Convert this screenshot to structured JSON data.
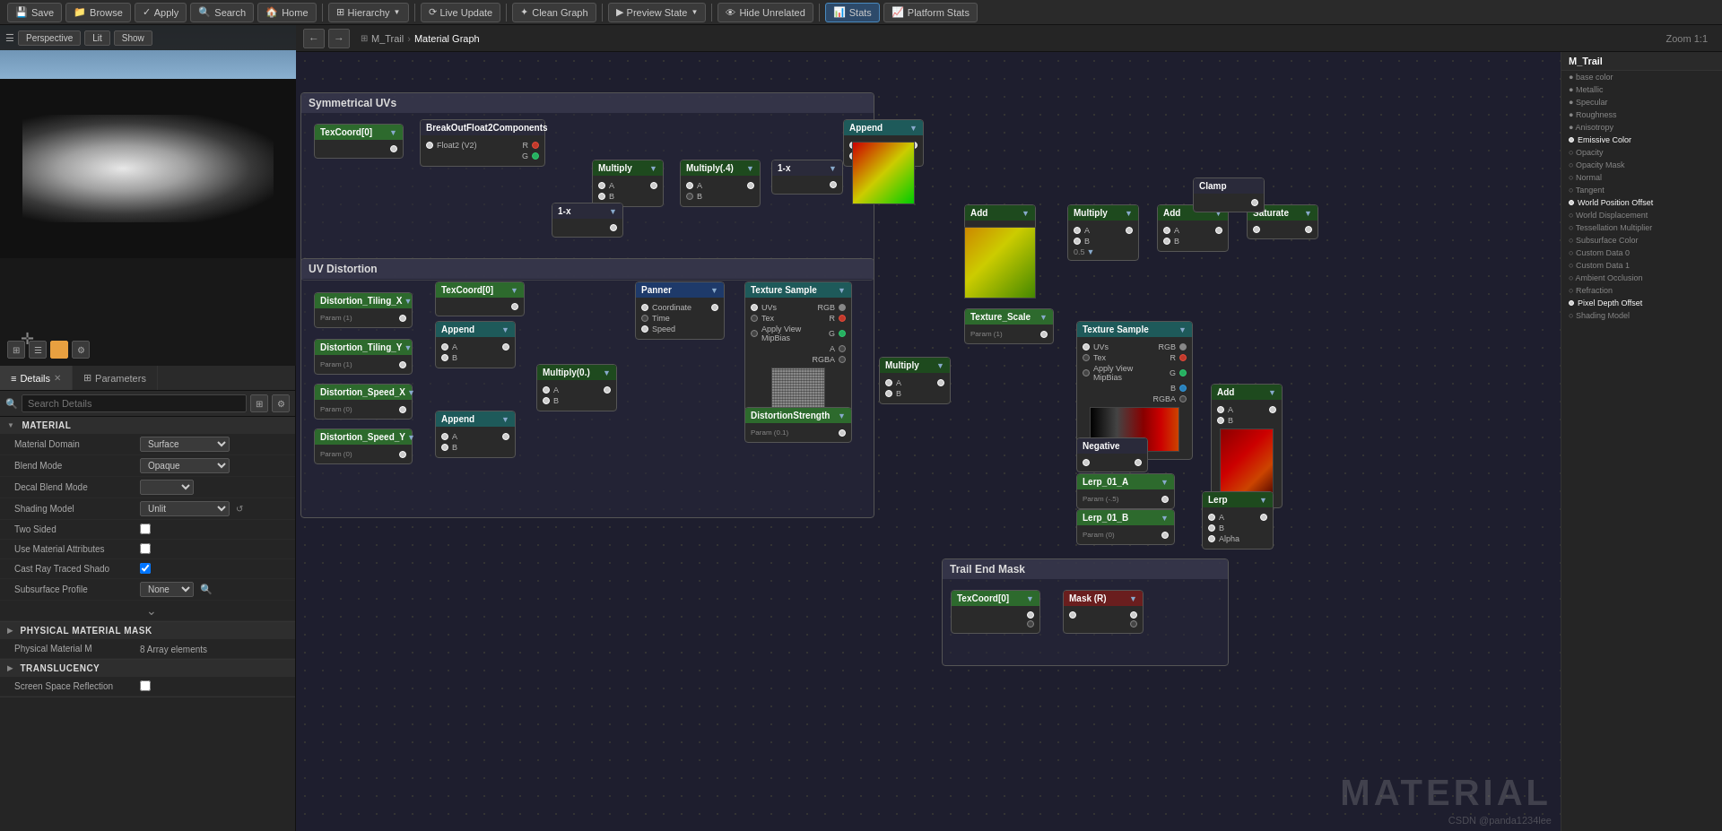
{
  "toolbar": {
    "save_label": "Save",
    "browse_label": "Browse",
    "apply_label": "Apply",
    "search_label": "Search",
    "home_label": "Home",
    "hierarchy_label": "Hierarchy",
    "live_update_label": "Live Update",
    "clean_graph_label": "Clean Graph",
    "preview_state_label": "Preview State",
    "hide_unrelated_label": "Hide Unrelated",
    "stats_label": "Stats",
    "platform_stats_label": "Platform Stats"
  },
  "viewport": {
    "mode_label": "Perspective",
    "lit_label": "Lit",
    "show_label": "Show"
  },
  "breadcrumb": {
    "root": "M_Trail",
    "separator": "›",
    "current": "Material Graph"
  },
  "zoom": "Zoom 1:1",
  "details": {
    "tab_label": "Details",
    "params_label": "Parameters",
    "search_placeholder": "Search Details",
    "sections": {
      "material": {
        "label": "MATERIAL",
        "domain_label": "Material Domain",
        "domain_value": "Surface",
        "blend_label": "Blend Mode",
        "blend_value": "Opaque",
        "decal_blend_label": "Decal Blend Mode",
        "shading_label": "Shading Model",
        "shading_value": "Unlit",
        "two_sided_label": "Two Sided",
        "use_mat_attrs_label": "Use Material Attributes",
        "cast_ray_label": "Cast Ray Traced Shado"
      },
      "subsurface_profile": {
        "label": "Subsurface Profile",
        "value": "None"
      },
      "physical_mask": {
        "label": "PHYSICAL MATERIAL MASK",
        "physical_label": "Physical Material M",
        "physical_value": "8 Array elements"
      },
      "translucency": {
        "label": "TRANSLUCENCY",
        "screen_space_label": "Screen Space Reflection"
      }
    }
  },
  "graph": {
    "symmetrical_uvs_label": "Symmetrical UVs",
    "uv_distortion_label": "UV Distortion",
    "trail_end_mask_label": "Trail End Mask",
    "nodes": {
      "tex_coord_0": "TexCoord[0]",
      "break_out_float2": "BreakOutFloat2Components",
      "float_v2": "Float2 (V2)",
      "multiply": "Multiply",
      "multiply_4": "Multiply(.4)",
      "one_minus_x": "1-x",
      "append": "Append",
      "add": "Add",
      "add2": "Add",
      "multiply2": "Multiply",
      "saturate": "Saturate",
      "clamp": "Clamp",
      "texture_scale": "Texture_Scale",
      "one_minus_x2": "1-x",
      "distortion_tiling_x": "Distortion_Tiling_X",
      "distortion_tiling_y": "Distortion_Tiling_Y",
      "distortion_speed_x": "Distortion_Speed_X",
      "distortion_speed_y": "Distortion_Speed_Y",
      "tex_coord_uv": "TexCoord[0]",
      "panner": "Panner",
      "texture_sample": "Texture Sample",
      "multiply_0": "Multiply(0.)",
      "append2": "Append",
      "append3": "Append",
      "distortion_strength": "DistortionStrength",
      "multiply3": "Multiply",
      "texture_sample2": "Texture Sample",
      "negative": "Negative",
      "lerp_01_a": "Lerp_01_A",
      "lerp_01_b": "Lerp_01_B",
      "lerp": "Lerp",
      "tex_coord_mask": "TexCoord[0]",
      "mask_r": "Mask (R)"
    },
    "pin_labels": {
      "uvs": "UVs",
      "tex": "Tex",
      "apply_view_mipbias": "Apply View MipBias",
      "rgb": "RGB",
      "r": "R",
      "g": "G",
      "b": "B",
      "a": "A",
      "rgba": "RGBA",
      "a_pin": "A",
      "b_pin": "B",
      "coordinate": "Coordinate",
      "time": "Time",
      "speed": "Speed",
      "alpha": "Alpha",
      "emissive_color": "Emissive Color",
      "world_position_offset": "World Position Offset",
      "pixel_depth_offset": "Pixel Depth Offset"
    }
  },
  "right_panel": {
    "title": "M_Trail",
    "items": [
      "Base Color",
      "Metallic",
      "Specular",
      "Roughness",
      "Anisotropy",
      "Emissive Color",
      "Opacity",
      "Opacity Mask",
      "Normal",
      "Tangent",
      "World Position Offset",
      "World Displacement",
      "Tessellation Multiplier",
      "Subsurface Color",
      "Custom Data 0",
      "Custom Data 1",
      "Ambient Occlusion",
      "Refraction",
      "Pixel Depth Offset",
      "Shading Model"
    ]
  },
  "watermark": {
    "text": "MATERIAL",
    "credit": "CSDN @panda1234lee"
  }
}
